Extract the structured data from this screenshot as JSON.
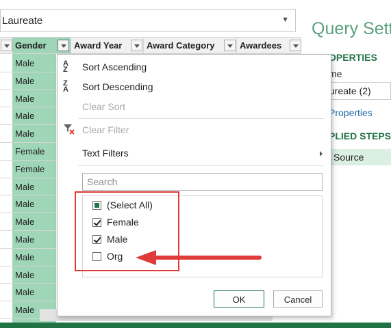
{
  "formula_bar": {
    "value": "Laureate"
  },
  "columns": [
    {
      "label": "Gender"
    },
    {
      "label": "Award Year"
    },
    {
      "label": "Award Category"
    },
    {
      "label": "Awardees"
    }
  ],
  "gender_values": [
    "Male",
    "Male",
    "Male",
    "Male",
    "Male",
    "Female",
    "Female",
    "Male",
    "Male",
    "Male",
    "Male",
    "Male",
    "Male",
    "Male",
    "Male"
  ],
  "menu": {
    "sort_ascending": "Sort Ascending",
    "sort_descending": "Sort Descending",
    "clear_sort": "Clear Sort",
    "clear_filter": "Clear Filter",
    "text_filters": "Text Filters",
    "search_placeholder": "Search",
    "items": [
      {
        "label": "(Select All)",
        "state": "partial"
      },
      {
        "label": "Female",
        "state": "checked"
      },
      {
        "label": "Male",
        "state": "checked"
      },
      {
        "label": "Org",
        "state": "unchecked"
      }
    ],
    "ok_label": "OK",
    "cancel_label": "Cancel"
  },
  "query_settings": {
    "title": "Query Setti",
    "properties_heading": "OPERTIES",
    "name_label": "me",
    "name_value": "ureate (2)",
    "all_properties_link": "Properties",
    "applied_steps_heading": "PLIED STEPS",
    "step_source": "Source"
  },
  "colors": {
    "accent_green": "#217346",
    "column_highlight": "#9fd6b8",
    "annotation_red": "#e03a3a"
  }
}
